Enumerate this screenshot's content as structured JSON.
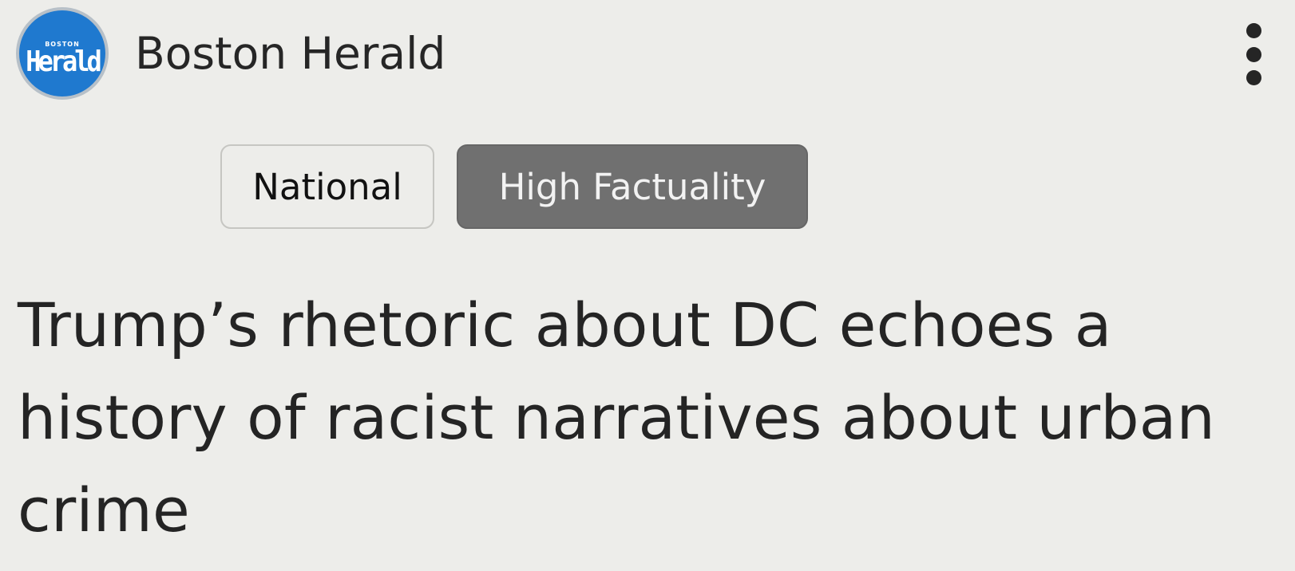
{
  "source": {
    "logo_small_text": "BOSTON",
    "logo_main_text": "Herald",
    "name": "Boston Herald"
  },
  "menu": {
    "icon": "more-vertical-icon"
  },
  "tags": {
    "national": "National",
    "factuality": "High Factuality"
  },
  "article": {
    "headline": "Trump’s rhetoric about DC echoes a history of racist narratives about urban crime"
  },
  "colors": {
    "background": "#ededea",
    "logo_blue": "#1f79cf",
    "factuality_bg": "#707070",
    "text": "#242424"
  }
}
